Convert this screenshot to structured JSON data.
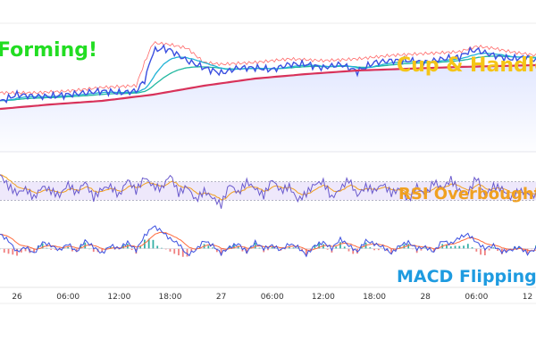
{
  "chart_data": {
    "type": "line",
    "colors": {
      "price": "#3b4fe0",
      "price_fill": "#dfe5ff",
      "ema_fast": "#21b3d6",
      "ema_mid": "#22b8a0",
      "ma_slow": "#d8325a",
      "band_upper": "#ff4d4d",
      "rsi": "#6a5acd",
      "rsi_signal": "#f0a020",
      "rsi_band": "#eee8fb",
      "macd": "#3b4fe0",
      "macd_signal": "#ff6b3d",
      "hist_up": "#35b0a6",
      "hist_down": "#f08080"
    },
    "xaxis": {
      "ticks": [
        {
          "label": "26",
          "t": 2
        },
        {
          "label": "06:00",
          "t": 8
        },
        {
          "label": "12:00",
          "t": 14
        },
        {
          "label": "18:00",
          "t": 20
        },
        {
          "label": "27",
          "t": 26
        },
        {
          "label": "06:00",
          "t": 32
        },
        {
          "label": "12:00",
          "t": 38
        },
        {
          "label": "18:00",
          "t": 44
        },
        {
          "label": "28",
          "t": 50
        },
        {
          "label": "06:00",
          "t": 56
        },
        {
          "label": "12",
          "t": 62
        }
      ],
      "range": [
        0,
        63
      ]
    },
    "annotations": [
      {
        "text": "Forming!",
        "color": "#22dd22",
        "panel": "price"
      },
      {
        "text": "Cup & Handle",
        "color": "#f5c518",
        "panel": "price"
      },
      {
        "text": "RSI Overbought",
        "color": "#f0a020",
        "panel": "rsi"
      },
      {
        "text": "MACD Flipping",
        "color": "#1e9be0",
        "panel": "macd"
      }
    ],
    "panels": {
      "price": {
        "ylim": [
          80,
          145
        ],
        "price": {
          "t": [
            0,
            2,
            4,
            6,
            8,
            10,
            12,
            14,
            16,
            17,
            18,
            19,
            20,
            22,
            24,
            26,
            28,
            30,
            32,
            34,
            36,
            38,
            40,
            42,
            44,
            46,
            48,
            50,
            52,
            54,
            55,
            56,
            58,
            60,
            62,
            63
          ],
          "v": [
            108,
            112,
            111,
            111,
            112,
            113,
            114,
            113,
            114,
            120,
            136,
            138,
            137,
            131,
            127,
            124,
            127,
            127,
            126,
            129,
            129,
            127,
            129,
            125,
            130,
            131,
            131,
            130,
            132,
            133,
            136,
            137,
            134,
            132,
            133,
            131
          ]
        },
        "ma_slow": {
          "t": [
            0,
            6,
            12,
            18,
            24,
            30,
            36,
            42,
            48,
            54,
            63
          ],
          "v": [
            104,
            106.5,
            108.5,
            112,
            117,
            121,
            123.5,
            125.5,
            126.5,
            127.5,
            128.5
          ]
        },
        "band_upper": {
          "t": [
            0,
            4,
            8,
            12,
            16,
            17,
            18,
            20,
            22,
            24,
            26,
            30,
            34,
            38,
            42,
            46,
            50,
            54,
            56,
            58,
            60,
            63
          ],
          "v": [
            113,
            113,
            114,
            116,
            117,
            130,
            141,
            140,
            138,
            130,
            129,
            130,
            132,
            131,
            132,
            134,
            135,
            136,
            139,
            138,
            136,
            134
          ]
        }
      },
      "rsi": {
        "ylim": [
          0,
          100
        ],
        "band": [
          30,
          70
        ],
        "rsi": {
          "t": [
            0,
            1,
            2,
            3,
            4,
            5,
            6,
            7,
            8,
            9,
            10,
            11,
            12,
            13,
            14,
            15,
            16,
            17,
            18,
            19,
            20,
            21,
            22,
            23,
            24,
            25,
            26,
            27,
            28,
            29,
            30,
            31,
            32,
            33,
            34,
            35,
            36,
            37,
            38,
            39,
            40,
            41,
            42,
            43,
            44,
            45,
            46,
            47,
            48,
            49,
            50,
            51,
            52,
            53,
            54,
            55,
            56,
            57,
            58,
            59,
            60,
            61,
            62,
            63
          ],
          "v": [
            85,
            60,
            45,
            55,
            35,
            60,
            50,
            40,
            65,
            45,
            70,
            35,
            55,
            60,
            40,
            75,
            50,
            80,
            60,
            55,
            85,
            45,
            60,
            30,
            50,
            35,
            20,
            65,
            45,
            70,
            55,
            40,
            75,
            50,
            60,
            30,
            45,
            65,
            70,
            35,
            55,
            75,
            40,
            60,
            50,
            65,
            45,
            55,
            30,
            60,
            40,
            70,
            55,
            75,
            50,
            45,
            80,
            40,
            60,
            55,
            35,
            50,
            45,
            40
          ]
        }
      },
      "macd": {
        "ylim": [
          -1.2,
          1.6
        ],
        "macd": {
          "t": [
            0,
            1,
            2,
            3,
            4,
            5,
            6,
            7,
            8,
            9,
            10,
            11,
            12,
            13,
            14,
            15,
            16,
            17,
            18,
            19,
            20,
            21,
            22,
            23,
            24,
            25,
            26,
            27,
            28,
            29,
            30,
            31,
            32,
            33,
            34,
            35,
            36,
            37,
            38,
            39,
            40,
            41,
            42,
            43,
            44,
            45,
            46,
            47,
            48,
            49,
            50,
            51,
            52,
            53,
            54,
            55,
            56,
            57,
            58,
            59,
            60,
            61,
            62,
            63
          ],
          "v": [
            0.9,
            0.5,
            -0.2,
            0.1,
            -0.3,
            0.4,
            0.2,
            -0.1,
            0.3,
            -0.2,
            0.5,
            0.1,
            -0.3,
            0.2,
            0.0,
            0.4,
            -0.1,
            0.8,
            1.4,
            1.1,
            0.6,
            0.3,
            -0.4,
            -0.1,
            0.5,
            0.2,
            -0.3,
            0.1,
            0.3,
            -0.2,
            0.4,
            0.0,
            0.2,
            -0.1,
            0.3,
            0.1,
            -0.4,
            0.2,
            0.4,
            0.0,
            0.6,
            0.2,
            -0.2,
            0.5,
            0.3,
            0.1,
            -0.3,
            0.2,
            0.4,
            0.0,
            0.1,
            -0.2,
            0.5,
            0.3,
            0.7,
            0.9,
            0.4,
            0.0,
            0.2,
            -0.2,
            -0.1,
            0.1,
            -0.3,
            0.0
          ]
        }
      }
    }
  }
}
